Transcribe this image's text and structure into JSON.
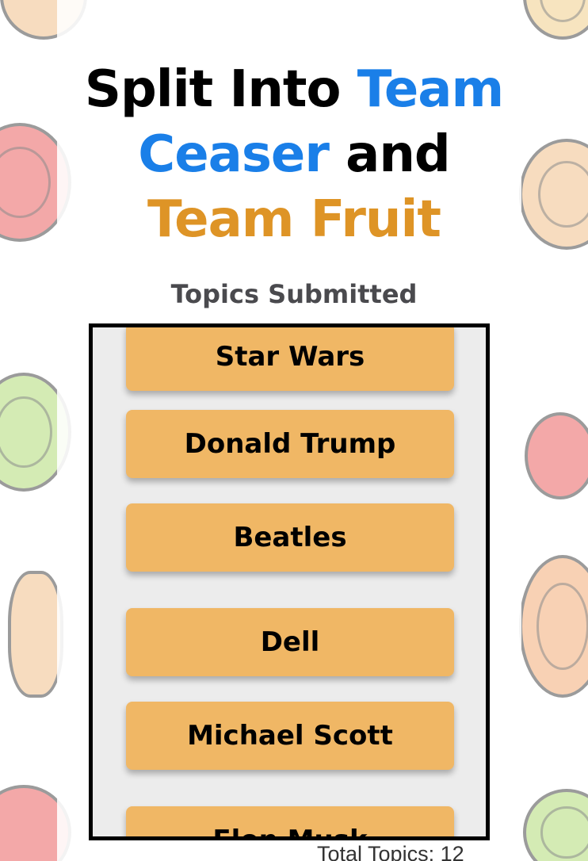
{
  "title": {
    "part1": "Split Into ",
    "team_ceaser": "Team Ceaser",
    "part2": " and ",
    "team_fruit": "Team Fruit"
  },
  "subtitle": "Topics Submitted",
  "topics": [
    "Star Wars",
    "Donald Trump",
    "Beatles",
    "Dell",
    "Michael Scott",
    "Elon Musk"
  ],
  "total_topics_label": "Total Topics: 12",
  "colors": {
    "team_ceaser": "#1a7fe8",
    "team_fruit": "#de9426",
    "topic_button": "#f0b765",
    "box_background": "#ececec"
  }
}
